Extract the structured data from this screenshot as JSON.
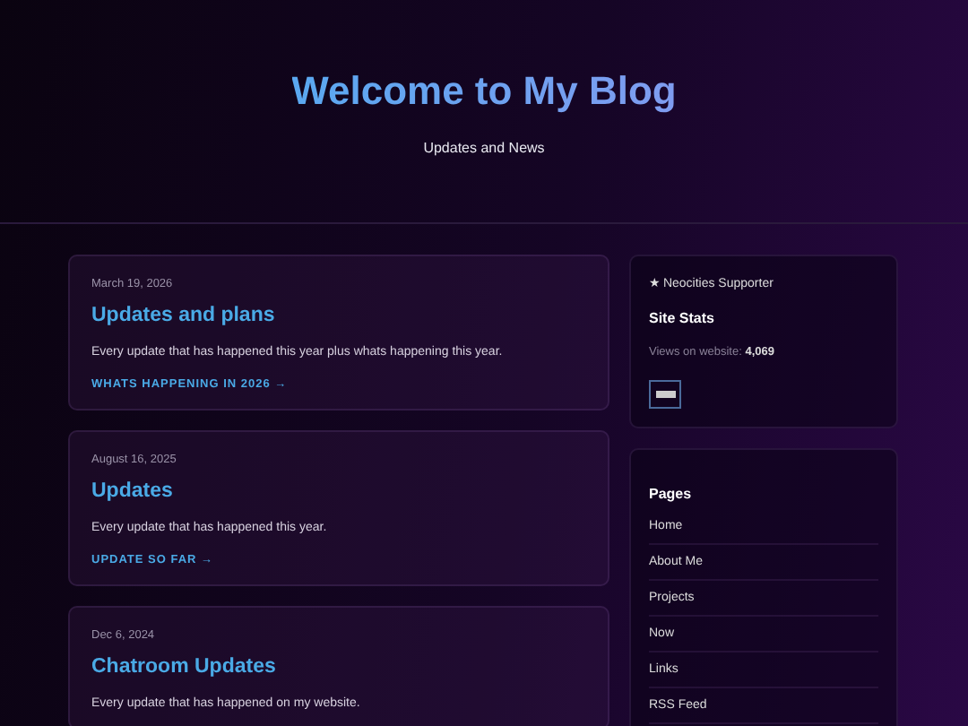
{
  "header": {
    "title": "Welcome to My Blog",
    "subtitle": "Updates and News"
  },
  "posts": [
    {
      "date": "March 19, 2026",
      "title": "Updates and plans",
      "excerpt": "Every update that has happened this year plus whats happening this year.",
      "link": "WHATS HAPPENING IN 2026 →"
    },
    {
      "date": "August 16, 2025",
      "title": "Updates",
      "excerpt": "Every update that has happened this year.",
      "link": "UPDATE SO FAR →"
    },
    {
      "date": "Dec 6, 2024",
      "title": "Chatroom Updates",
      "excerpt": "Every update that has happened on my website."
    }
  ],
  "sidebar": {
    "supporter": "★ Neocities Supporter",
    "stats_title": "Site Stats",
    "views_label": "Views on website:",
    "views_count": "4,069",
    "pages_title": "Pages",
    "pages": [
      "Home",
      "About Me",
      "Projects",
      "Now",
      "Links",
      "RSS Feed"
    ]
  }
}
